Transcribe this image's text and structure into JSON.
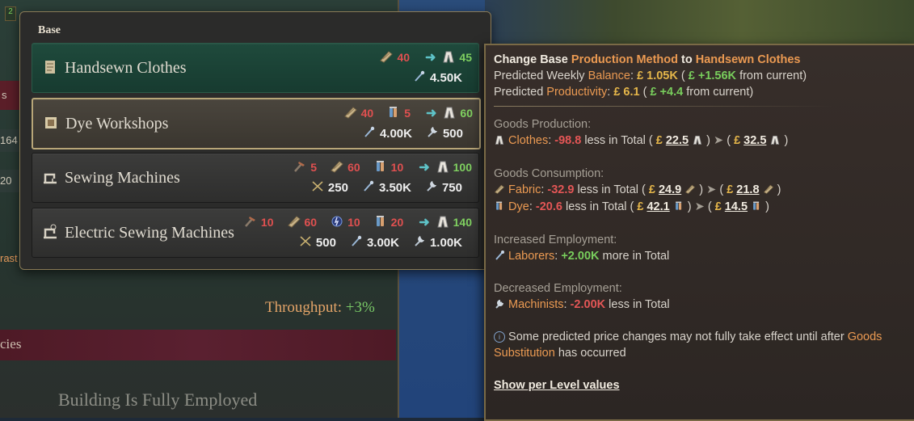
{
  "building_panel": {
    "edge_badge": "2",
    "edge_s": "s",
    "edge_164": "164",
    "edge_20": "20",
    "edge_rast": "rast",
    "throughput_label": "Throughput:",
    "throughput_value": "+3%",
    "cies": "cies",
    "status": "Building Is Fully Employed"
  },
  "dropdown": {
    "title": "Base",
    "methods": [
      {
        "name": "Handsewn Clothes",
        "state": "current",
        "icon": "handsewn-icon",
        "inputs": [
          {
            "good": "fabric-icon",
            "amount": "40"
          }
        ],
        "outputs": [
          {
            "good": "clothes-icon",
            "amount": "45"
          }
        ],
        "employment": [
          {
            "job": "laborers-icon",
            "amount": "4.50K"
          }
        ]
      },
      {
        "name": "Dye Workshops",
        "state": "hover",
        "icon": "dye-workshop-icon",
        "inputs": [
          {
            "good": "fabric-icon",
            "amount": "40"
          },
          {
            "good": "dye-icon",
            "amount": "5"
          }
        ],
        "outputs": [
          {
            "good": "clothes-icon",
            "amount": "60"
          }
        ],
        "employment": [
          {
            "job": "laborers-icon",
            "amount": "4.00K"
          },
          {
            "job": "machinists-icon",
            "amount": "500"
          }
        ]
      },
      {
        "name": "Sewing Machines",
        "state": "normal",
        "icon": "sewing-machine-icon",
        "inputs": [
          {
            "good": "tools-icon",
            "amount": "5"
          },
          {
            "good": "fabric-icon",
            "amount": "60"
          },
          {
            "good": "dye-icon",
            "amount": "10"
          }
        ],
        "outputs": [
          {
            "good": "clothes-icon",
            "amount": "100"
          }
        ],
        "employment": [
          {
            "job": "engineers-icon",
            "amount": "250"
          },
          {
            "job": "laborers-icon",
            "amount": "3.50K"
          },
          {
            "job": "machinists-icon",
            "amount": "750"
          }
        ]
      },
      {
        "name": "Electric Sewing Machines",
        "state": "normal",
        "icon": "electric-sewing-machine-icon",
        "inputs": [
          {
            "good": "tools-icon",
            "amount": "10"
          },
          {
            "good": "fabric-icon",
            "amount": "60"
          },
          {
            "good": "electricity-icon",
            "amount": "10"
          },
          {
            "good": "dye-icon",
            "amount": "20"
          }
        ],
        "outputs": [
          {
            "good": "clothes-icon",
            "amount": "140"
          }
        ],
        "employment": [
          {
            "job": "engineers-icon",
            "amount": "500"
          },
          {
            "job": "laborers-icon",
            "amount": "3.00K"
          },
          {
            "job": "machinists-icon",
            "amount": "1.00K"
          }
        ]
      }
    ]
  },
  "tooltip": {
    "title_prefix": "Change Base",
    "title_hl": "Production Method",
    "title_to": "to",
    "title_target": "Handsewn Clothes",
    "balance": {
      "pre": "Predicted Weekly",
      "hl": "Balance",
      "value": "£ 1.05K",
      "open": "(",
      "delta": "£ +1.56K",
      "post": "from current)"
    },
    "productivity": {
      "pre": "Predicted",
      "hl": "Productivity",
      "value": "£ 6.1",
      "open": "(",
      "delta": "£ +4.4",
      "post": "from current)"
    },
    "goods_production": {
      "header": "Goods Production:",
      "items": [
        {
          "icon": "clothes-icon",
          "name": "Clothes",
          "delta": "-98.8",
          "mid": "less in Total",
          "price_from": "22.5",
          "price_to": "32.5"
        }
      ]
    },
    "goods_consumption": {
      "header": "Goods Consumption:",
      "items": [
        {
          "icon": "fabric-icon",
          "name": "Fabric",
          "delta": "-32.9",
          "mid": "less in Total",
          "price_from": "24.9",
          "price_to": "21.8"
        },
        {
          "icon": "dye-icon",
          "name": "Dye",
          "delta": "-20.6",
          "mid": "less in Total",
          "price_from": "42.1",
          "price_to": "14.5"
        }
      ]
    },
    "increased_employment": {
      "header": "Increased Employment:",
      "name": "Laborers",
      "delta": "+2.00K",
      "tail": "more in Total"
    },
    "decreased_employment": {
      "header": "Decreased Employment:",
      "name": "Machinists",
      "delta": "-2.00K",
      "tail": "less in Total"
    },
    "note": {
      "line1": "Some predicted price changes may not fully take effect until after",
      "hl1": "Goods",
      "hl2": "Substitution",
      "line2": "has occurred"
    },
    "link": "Show per Level values"
  },
  "colors": {
    "highlight": "#eb9a52",
    "positive": "#78cd5c",
    "negative": "#e45656",
    "border": "#7a6a46"
  }
}
